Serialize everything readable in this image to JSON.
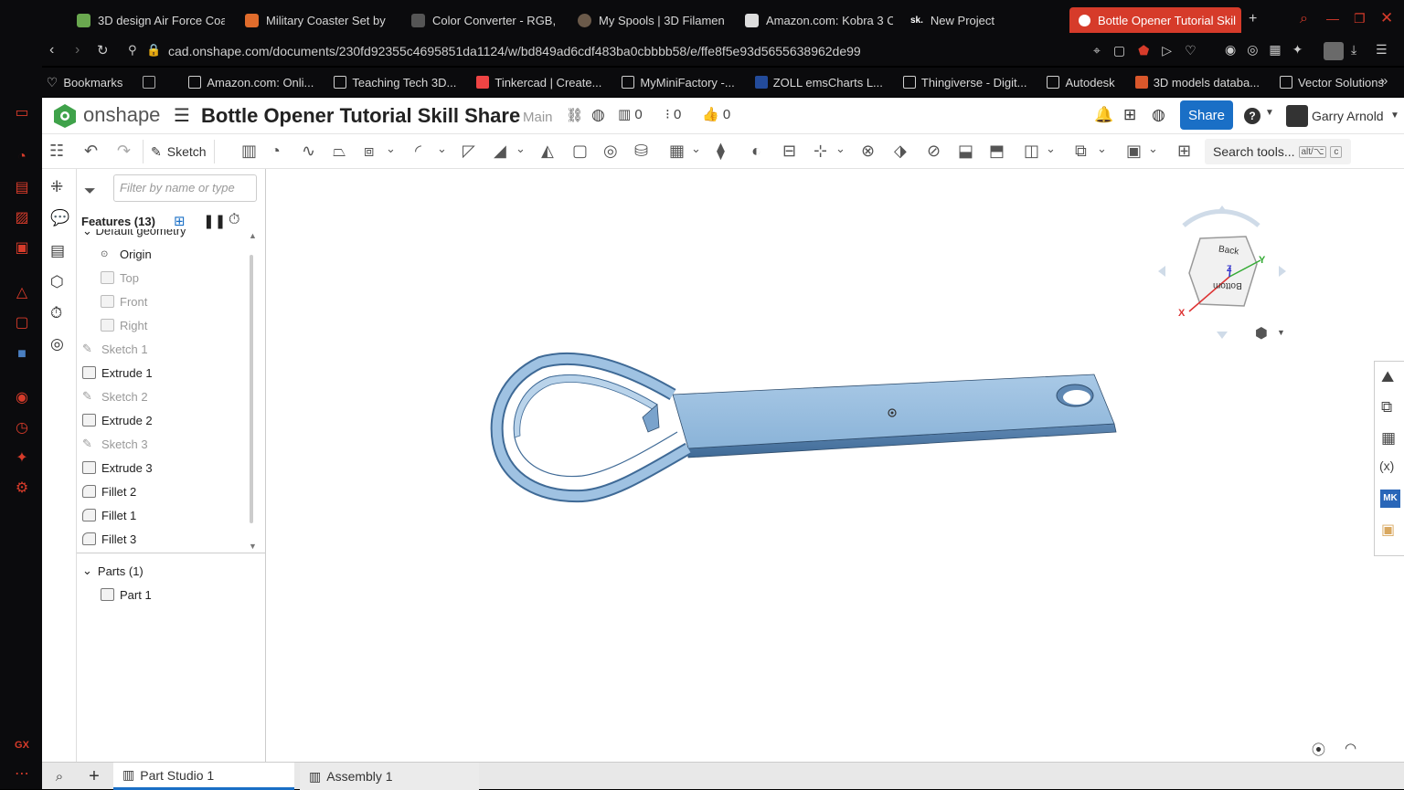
{
  "browser": {
    "tabs": [
      {
        "label": "3D design Air Force Coa",
        "color": "#6aa84f"
      },
      {
        "label": "Military Coaster Set by",
        "color": "#e06c2c"
      },
      {
        "label": "Color Converter - RGB,",
        "color": "#444"
      },
      {
        "label": "My Spools | 3D Filamen",
        "color": "#6b5a4a"
      },
      {
        "label": "Amazon.com: Kobra 3 C",
        "color": "#ddd"
      },
      {
        "label": "New Project",
        "color": "#222"
      },
      {
        "label": "Bottle Opener Tutorial Skil",
        "color": "#2b8a3e"
      }
    ],
    "new_tab": "+",
    "url": "cad.onshape.com/documents/230fd92355c4695851da1124/w/bd849ad6cdf483ba0cbbbb58/e/ffe8f5e93d5655638962de99",
    "bookmarks": [
      "Bookmarks",
      "Amazon.com: Onli...",
      "Teaching Tech 3D...",
      "Tinkercad | Create...",
      "MyMiniFactory -...",
      "ZOLL emsCharts L...",
      "Thingiverse - Digit...",
      "Autodesk",
      "3D models databa...",
      "Vector Solutions"
    ],
    "sidebar_label": "GX"
  },
  "app": {
    "logo_text": "onshape",
    "doc_title": "Bottle Opener Tutorial Skill Share",
    "branch": "Main",
    "counts": {
      "versions": "0",
      "branches": "0",
      "likes": "0"
    },
    "share_label": "Share",
    "help_label": "?",
    "user_name": "Garry Arnold",
    "accent": "#1a6fc6"
  },
  "toolbar": {
    "sketch_label": "Sketch",
    "search_label": "Search tools...",
    "search_shortcut_1": "alt/⌥",
    "search_shortcut_2": "c"
  },
  "panel": {
    "filter_placeholder": "Filter by name or type",
    "features_header": "Features (13)",
    "default_geometry": "Default geometry",
    "features": [
      {
        "label": "Origin",
        "kind": "origin",
        "dim": false
      },
      {
        "label": "Top",
        "kind": "plane",
        "dim": true
      },
      {
        "label": "Front",
        "kind": "plane",
        "dim": true
      },
      {
        "label": "Right",
        "kind": "plane",
        "dim": true
      },
      {
        "label": "Sketch 1",
        "kind": "sketch",
        "dim": true
      },
      {
        "label": "Extrude 1",
        "kind": "extrude",
        "dim": false
      },
      {
        "label": "Sketch 2",
        "kind": "sketch",
        "dim": true
      },
      {
        "label": "Extrude 2",
        "kind": "extrude",
        "dim": false
      },
      {
        "label": "Sketch 3",
        "kind": "sketch",
        "dim": true
      },
      {
        "label": "Extrude 3",
        "kind": "extrude",
        "dim": false
      },
      {
        "label": "Fillet 2",
        "kind": "fillet",
        "dim": false
      },
      {
        "label": "Fillet 1",
        "kind": "fillet",
        "dim": false
      },
      {
        "label": "Fillet 3",
        "kind": "fillet",
        "dim": false
      }
    ],
    "parts_header": "Parts (1)",
    "parts": [
      "Part 1"
    ]
  },
  "viewcube": {
    "face_back": "Back",
    "face_bottom": "Bottom",
    "axis_x": "X",
    "axis_y": "Y",
    "axis_z": "Z"
  },
  "bottom_tabs": [
    {
      "label": "Part Studio 1",
      "active": true
    },
    {
      "label": "Assembly 1",
      "active": false
    }
  ],
  "right_panel": {
    "mk_label": "MK"
  }
}
